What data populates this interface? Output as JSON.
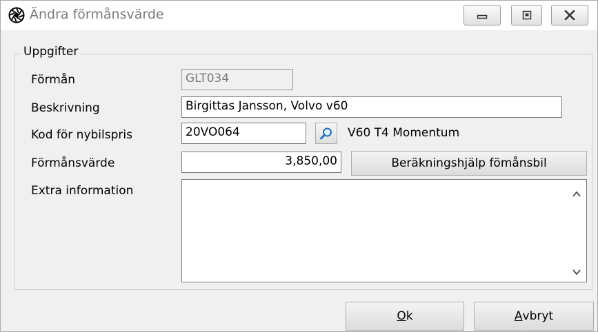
{
  "window": {
    "title": "Ändra förmånsvärde",
    "icons": {
      "app": "aperture-icon",
      "minimize": "minimize-icon",
      "maximize": "maximize-icon",
      "close": "close-icon"
    }
  },
  "group": {
    "legend": "Uppgifter"
  },
  "fields": {
    "benefit": {
      "label": "Förmån",
      "value": "GLT034"
    },
    "description": {
      "label": "Beskrivning",
      "value": "Birgittas Jansson, Volvo v60"
    },
    "car_price_code": {
      "label": "Kod för nybilspris",
      "value": "20VO064",
      "lookup_icon": "search-icon",
      "resolved_text": "V60 T4 Momentum"
    },
    "benefit_value": {
      "label": "Förmånsvärde",
      "value": "3,850,00",
      "calc_button": "Beräkningshjälp fömånsbil"
    },
    "extra_info": {
      "label": "Extra information",
      "value": ""
    }
  },
  "buttons": {
    "ok": {
      "accel": "O",
      "rest": "k"
    },
    "cancel": {
      "accel": "A",
      "rest": "vbryt"
    }
  }
}
